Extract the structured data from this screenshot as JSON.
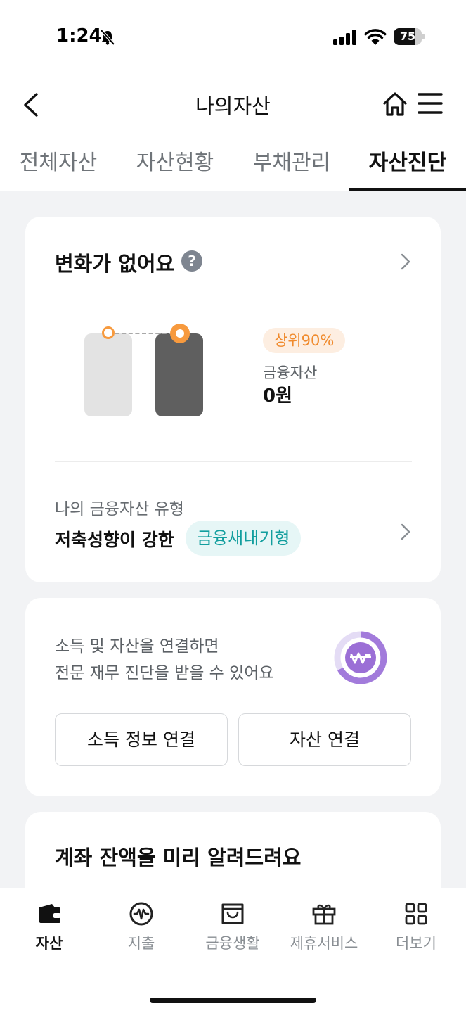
{
  "status_bar": {
    "time": "1:24",
    "battery": "75",
    "battery_level": 0.75
  },
  "header": {
    "title": "나의자산",
    "icons": [
      "back-arrow-icon",
      "home-icon",
      "hamburger-menu-icon"
    ]
  },
  "tabs": [
    {
      "label": "전체자산",
      "active": false
    },
    {
      "label": "자산현황",
      "active": false
    },
    {
      "label": "부채관리",
      "active": false
    },
    {
      "label": "자산진단",
      "active": true
    }
  ],
  "change_card": {
    "title": "변화가 없어요",
    "help_symbol": "?",
    "rank_badge": "상위90%",
    "asset_label": "금융자산",
    "asset_value": "0원",
    "type_label": "나의 금융자산 유형",
    "type_desc": "저축성향이 강한",
    "type_badge": "금융새내기형"
  },
  "connect_card": {
    "line1": "소득 및 자산을 연결하면",
    "line2": "전문 재무 진단을 받을 수 있어요",
    "income_button": "소득 정보 연결",
    "asset_button": "자산 연결"
  },
  "balance_card": {
    "title": "계좌 잔액을 미리 알려드려요"
  },
  "bottom_nav": [
    {
      "label": "자산",
      "icon": "wallet-icon",
      "active": true
    },
    {
      "label": "지출",
      "icon": "won-pulse-icon",
      "active": false
    },
    {
      "label": "금융생활",
      "icon": "shopping-bag-icon",
      "active": false
    },
    {
      "label": "제휴서비스",
      "icon": "gift-icon",
      "active": false
    },
    {
      "label": "더보기",
      "icon": "grid-icon",
      "active": false
    }
  ],
  "colors": {
    "accent_orange": "#f79a3e",
    "teal": "#129e9e",
    "purple": "#9b6fd6"
  }
}
